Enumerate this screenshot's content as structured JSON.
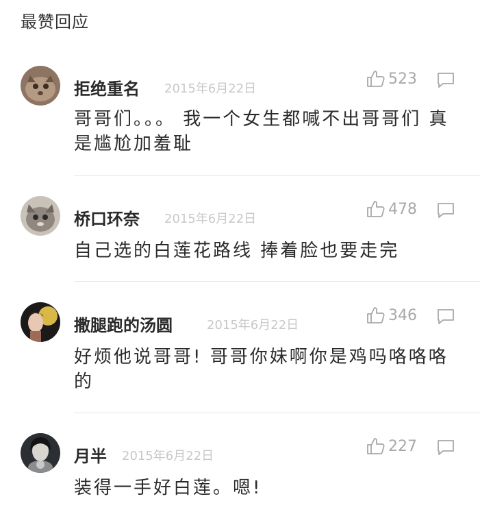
{
  "section_title": "最赞回应",
  "comments": [
    {
      "username": "拒绝重名",
      "date": "2015年6月22日",
      "likes": "523",
      "text": "哥哥们。。。 我一个女生都喊不出哥哥们 真是尴尬加羞耻",
      "avatar_icon": "cat-avatar-icon"
    },
    {
      "username": "桥口环奈",
      "date": "2015年6月22日",
      "likes": "478",
      "text": "自己选的白莲花路线 捧着脸也要走完",
      "avatar_icon": "cat-avatar-icon"
    },
    {
      "username": "撒腿跑的汤圆",
      "date": "2015年6月22日",
      "likes": "346",
      "text": "好烦他说哥哥! 哥哥你妹啊你是鸡吗咯咯咯的",
      "avatar_icon": "person-avatar-icon"
    },
    {
      "username": "月半",
      "date": "2015年6月22日",
      "likes": "227",
      "text": "装得一手好白莲。嗯!",
      "avatar_icon": "person-avatar-icon"
    }
  ],
  "colors": {
    "text": "#2a2a2a",
    "meta": "#c8c8c8",
    "icon": "#a8a8a8",
    "divider": "#e6e6e6"
  }
}
